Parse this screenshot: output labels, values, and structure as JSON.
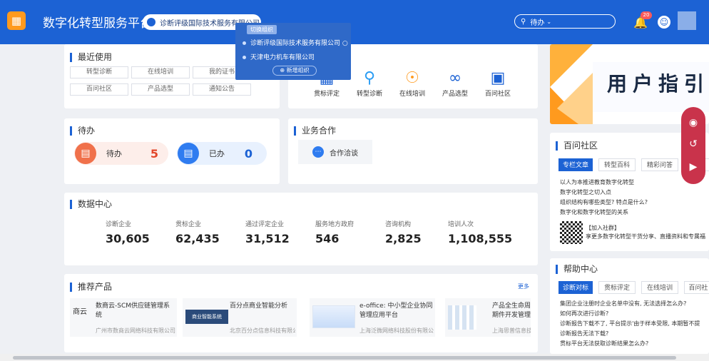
{
  "header": {
    "app_title": "数字化转型服务平台",
    "org_name": "诊断评级国际技术服务有限公司",
    "search_placeholder": "待办",
    "notification_count": "20"
  },
  "org_dropdown": {
    "switch_label": "切换组织",
    "orgs": [
      "诊断评级国际技术服务有限公司",
      "天津电力机车有限公司"
    ],
    "add_label": "新增组织"
  },
  "recent": {
    "title": "最近使用",
    "items": [
      "转型诊断",
      "在线培训",
      "我的证书",
      "百问社区",
      "产品选型",
      "通知公告"
    ]
  },
  "quick": {
    "items": [
      {
        "label": "贯标评定",
        "icon": "certification-icon"
      },
      {
        "label": "转型诊断",
        "icon": "diagnosis-icon"
      },
      {
        "label": "在线培训",
        "icon": "training-icon"
      },
      {
        "label": "产品选型",
        "icon": "product-icon"
      },
      {
        "label": "百问社区",
        "icon": "community-icon"
      }
    ]
  },
  "todo": {
    "title": "待办",
    "pending_label": "待办",
    "pending_count": "5",
    "done_label": "已办",
    "done_count": "0"
  },
  "cooperation": {
    "title": "业务合作",
    "button_label": "合作洽谈"
  },
  "data_center": {
    "title": "数据中心",
    "stats": [
      {
        "label": "诊断企业",
        "value": "30,605"
      },
      {
        "label": "贯标企业",
        "value": "62,435"
      },
      {
        "label": "通过评定企业",
        "value": "31,512"
      },
      {
        "label": "服务地方政府",
        "value": "546"
      },
      {
        "label": "咨询机构",
        "value": "2,825"
      },
      {
        "label": "培训人次",
        "value": "1,108,555"
      }
    ]
  },
  "products": {
    "title": "推荐产品",
    "more": "更多",
    "items": [
      {
        "name": "数商云-SCM供应链管理系统",
        "company": "广州市数商云网络科技有限公司",
        "thumb": "商云"
      },
      {
        "name": "百分点商业智能分析",
        "company": "北京百分点信息科技有限公司",
        "thumb": "商业智能系统"
      },
      {
        "name": "e-office: 中小型企业协同管理应用平台",
        "company": "上海泛微网络科技股份有限公司",
        "thumb": ""
      },
      {
        "name": "产品全生命周期件开发管理",
        "company": "上海思普信息技",
        "thumb": ""
      }
    ]
  },
  "guide_banner": {
    "text": "用户指引"
  },
  "forum": {
    "title": "百问社区",
    "tabs": [
      "专栏文章",
      "转型百科",
      "精彩问答",
      "关"
    ],
    "posts": [
      "以人为本推进教育数字化转型",
      "数字化转型之切入点",
      "组织结构有哪些类型? 特点是什么?",
      "数字化和数字化转型的关系"
    ],
    "qr_title": "【加入社群】",
    "qr_desc": "享更多数字化转型干货分享、直播资料和专属福"
  },
  "help": {
    "title": "帮助中心",
    "tabs": [
      "诊断对标",
      "贯标评定",
      "在线培训",
      "百问社"
    ],
    "questions": [
      "集团企业注册时企业名单中没有, 无法选择怎么办?",
      "如何再次进行诊断?",
      "诊断报告下载不了, 平台提示'由于样本受限, 本期暂不提",
      "诊断报告无法下载?",
      "贯标平台无法获取诊断结果怎么办?"
    ]
  },
  "colors": {
    "primary": "#1c62d4",
    "accent": "#ff9a1e",
    "float": "#c9334b"
  }
}
